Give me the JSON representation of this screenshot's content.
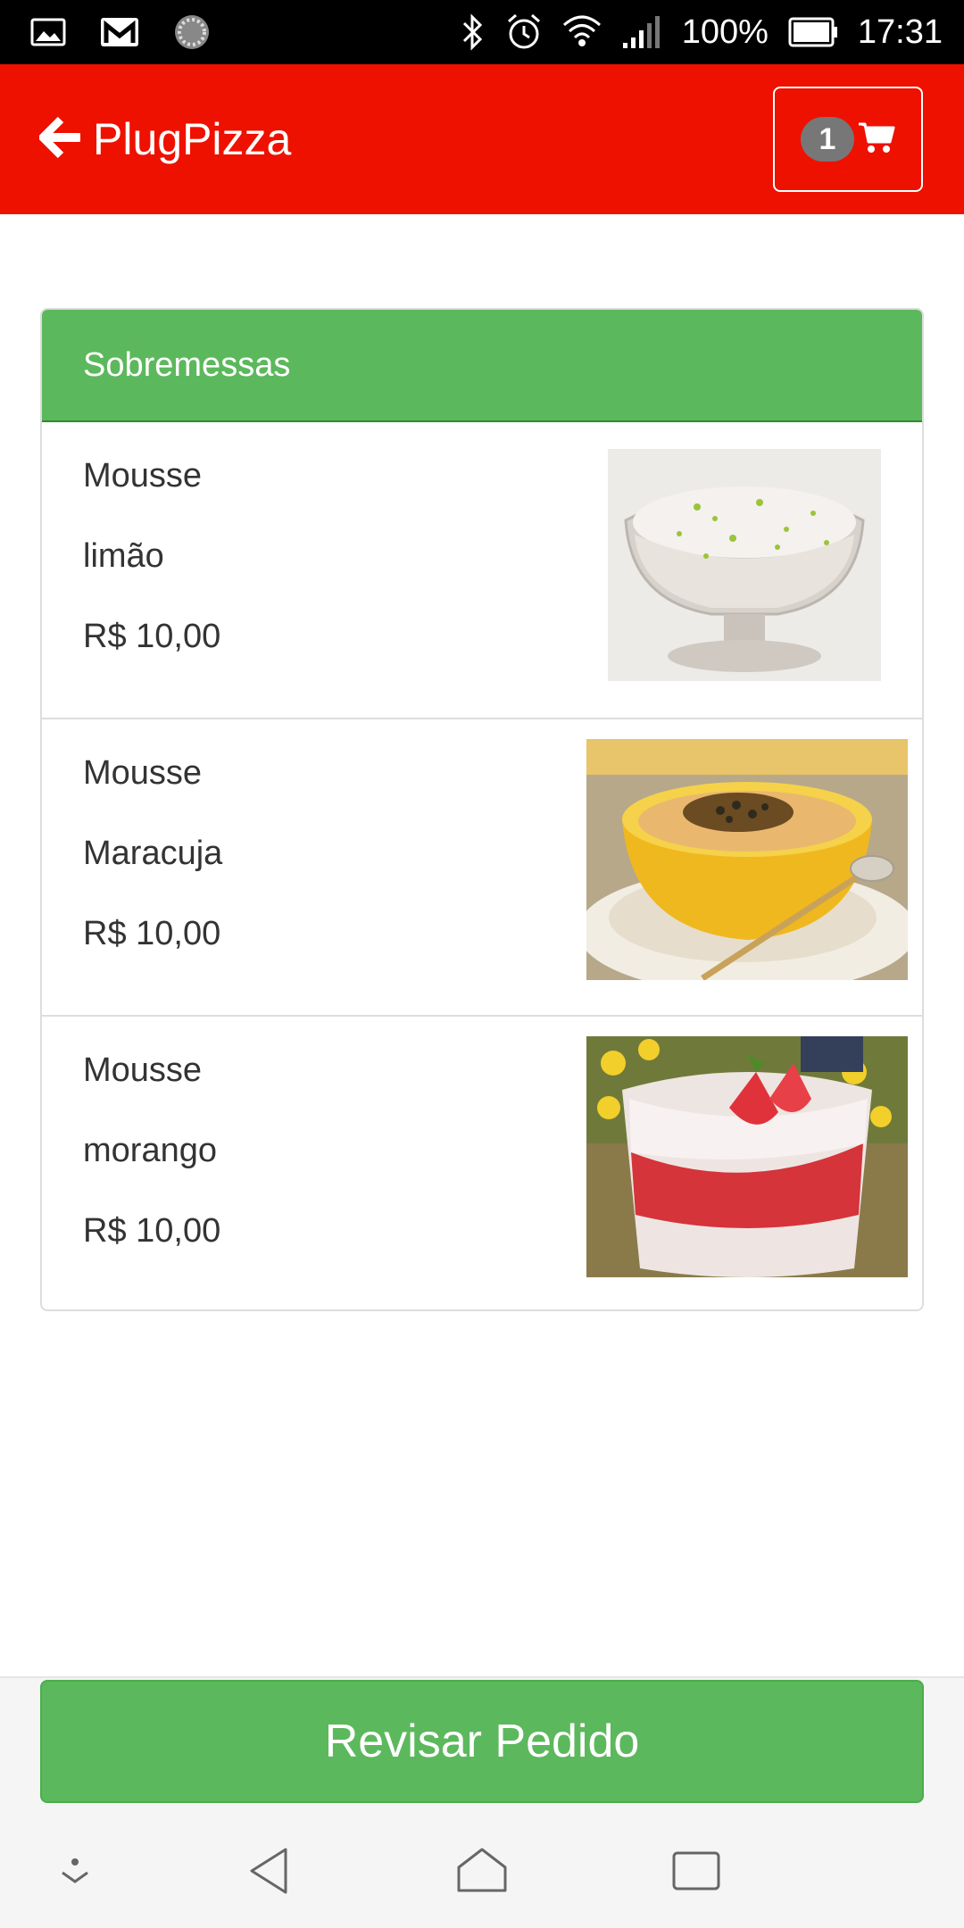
{
  "status_bar": {
    "battery_percent": "100%",
    "time": "17:31",
    "icons": [
      "gallery-icon",
      "gmail-icon",
      "sync-icon",
      "bluetooth-icon",
      "alarm-icon",
      "wifi-icon",
      "signal-icon",
      "battery-icon"
    ]
  },
  "app_bar": {
    "title": "PlugPizza",
    "back_icon": "arrow-left-icon",
    "cart_count": "1",
    "cart_icon": "cart-icon",
    "color": "#ee1100"
  },
  "category": {
    "title": "Sobremessas",
    "color": "#5cb85c",
    "items": [
      {
        "name_line1": "Mousse",
        "name_line2": "limão",
        "price": "R$ 10,00",
        "image": "lime-mousse-photo"
      },
      {
        "name_line1": "Mousse",
        "name_line2": "Maracuja",
        "price": "R$ 10,00",
        "image": "passion-fruit-mousse-photo"
      },
      {
        "name_line1": "Mousse",
        "name_line2": "morango",
        "price": "R$ 10,00",
        "image": "strawberry-mousse-photo"
      }
    ]
  },
  "footer": {
    "review_button": "Revisar Pedido"
  },
  "nav_bar": {
    "buttons": [
      "hide-keyboard-icon",
      "back-icon",
      "home-icon",
      "recents-icon"
    ]
  }
}
